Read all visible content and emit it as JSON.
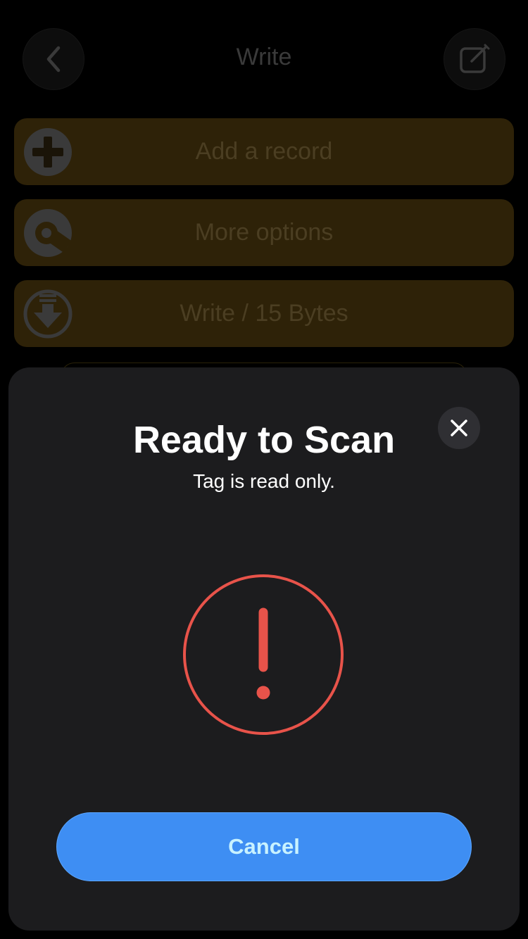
{
  "nav": {
    "title": "Write",
    "back_icon": "chevron-left-icon",
    "edit_icon": "compose-icon"
  },
  "actions": [
    {
      "label": "Add a record",
      "icon": "plus-circle-icon"
    },
    {
      "label": "More options",
      "icon": "wrench-circle-icon"
    },
    {
      "label": "Write / 15 Bytes",
      "icon": "download-circle-icon"
    }
  ],
  "scan_sheet": {
    "title": "Ready to Scan",
    "message": "Tag is read only.",
    "cancel_label": "Cancel",
    "status_icon": "exclamation-circle-icon",
    "close_icon": "close-icon"
  },
  "colors": {
    "background": "#000000",
    "sheet_background": "#1c1c1e",
    "action_row_dimmed": "#2e2208",
    "alert_red": "#e8534a",
    "cancel_blue": "#3e8ef3",
    "cancel_text": "#c8f2ff"
  }
}
